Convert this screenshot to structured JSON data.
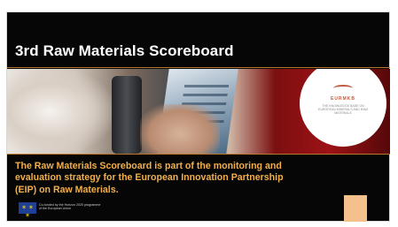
{
  "slide": {
    "title": "3rd Raw Materials Scoreboard",
    "description": "The Raw Materials Scoreboard is part of the monitoring and evaluation strategy for the European Innovation Partnership (EIP) on Raw Materials.",
    "logo": {
      "brand": "EURMKB",
      "tagline": "THE KNOWLEDGE BASE ON EUROPEAN MINERALS AND RAW MATERIALS"
    },
    "eu": {
      "stars": "✶ ✶ ✶",
      "funding_text": "Co-funded by the Horizon 2020 programme of the European Union"
    }
  },
  "colors": {
    "background": "#060606",
    "title": "#ffffff",
    "description": "#f3b04a",
    "rule": "#b7772c",
    "eu_blue": "#1f3f97",
    "accent_peach": "#f4c08c"
  }
}
